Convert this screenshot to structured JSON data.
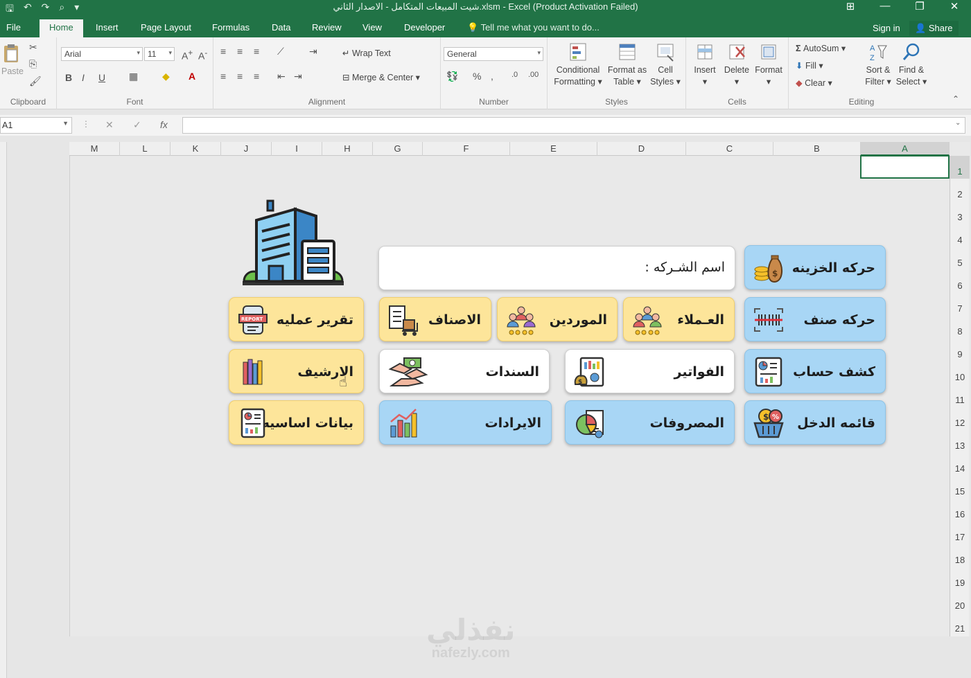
{
  "window": {
    "title": "شيت المبيعات المتكامل - الاصدار الثاني.xlsm - Excel (Product Activation Failed)"
  },
  "tabs": [
    "File",
    "Home",
    "Insert",
    "Page Layout",
    "Formulas",
    "Data",
    "Review",
    "View",
    "Developer"
  ],
  "tell_me": "Tell me what you want to do...",
  "sign_in": "Sign in",
  "share": "Share",
  "ribbon": {
    "clipboard": {
      "paste": "Paste",
      "label": "Clipboard"
    },
    "font": {
      "name": "Arial",
      "size": "11",
      "label": "Font",
      "bold": "B",
      "italic": "I",
      "underline": "U"
    },
    "alignment": {
      "wrap": "Wrap Text",
      "merge": "Merge & Center",
      "label": "Alignment"
    },
    "number": {
      "format": "General",
      "percent": "%",
      "label": "Number"
    },
    "styles": {
      "conditional_1": "Conditional",
      "conditional_2": "Formatting",
      "format_table_1": "Format as",
      "format_table_2": "Table",
      "cell_styles_1": "Cell",
      "cell_styles_2": "Styles",
      "label": "Styles"
    },
    "cells": {
      "insert": "Insert",
      "delete": "Delete",
      "format": "Format",
      "label": "Cells"
    },
    "editing": {
      "autosum": "AutoSum",
      "fill": "Fill",
      "clear": "Clear",
      "sort_1": "Sort &",
      "sort_2": "Filter",
      "find_1": "Find &",
      "find_2": "Select",
      "label": "Editing"
    }
  },
  "formula_bar": {
    "name_box": "A1",
    "fx": "fx",
    "value": ""
  },
  "columns": [
    "M",
    "L",
    "K",
    "J",
    "I",
    "H",
    "G",
    "F",
    "E",
    "D",
    "C",
    "B",
    "A"
  ],
  "rows": [
    "1",
    "2",
    "3",
    "4",
    "5",
    "6",
    "7",
    "8",
    "9",
    "10",
    "11",
    "12",
    "13",
    "14",
    "15",
    "16",
    "17",
    "18",
    "19",
    "20",
    "21"
  ],
  "selected_cell": "A1",
  "dashboard": {
    "company_label": "اسم الشـركه :",
    "buttons": [
      {
        "label": "حركه الخزينه",
        "icon": "money-bag-icon",
        "color": "blue"
      },
      {
        "label": "حركه صنف",
        "icon": "barcode-icon",
        "color": "blue"
      },
      {
        "label": "العـملاء",
        "icon": "customers-icon",
        "color": "yellow"
      },
      {
        "label": "الموردين",
        "icon": "suppliers-icon",
        "color": "yellow"
      },
      {
        "label": "الاصناف",
        "icon": "inventory-icon",
        "color": "yellow"
      },
      {
        "label": "تقرير عمليه",
        "icon": "report-icon",
        "color": "yellow"
      },
      {
        "label": "كشف حساب",
        "icon": "account-statement-icon",
        "color": "blue"
      },
      {
        "label": "الفواتير",
        "icon": "invoice-icon",
        "color": "white"
      },
      {
        "label": "السندات",
        "icon": "handshake-money-icon",
        "color": "white"
      },
      {
        "label": "الارشيف",
        "icon": "archive-books-icon",
        "color": "yellow"
      },
      {
        "label": "قائمه الدخل",
        "icon": "income-basket-icon",
        "color": "blue"
      },
      {
        "label": "المصروفات",
        "icon": "expenses-chart-icon",
        "color": "blue"
      },
      {
        "label": "الايرادات",
        "icon": "revenue-chart-icon",
        "color": "blue"
      },
      {
        "label": "بيانات اساسيه",
        "icon": "basic-data-icon",
        "color": "yellow"
      }
    ]
  },
  "watermark": {
    "arabic": "نفذلي",
    "latin": "nafezly.com"
  }
}
